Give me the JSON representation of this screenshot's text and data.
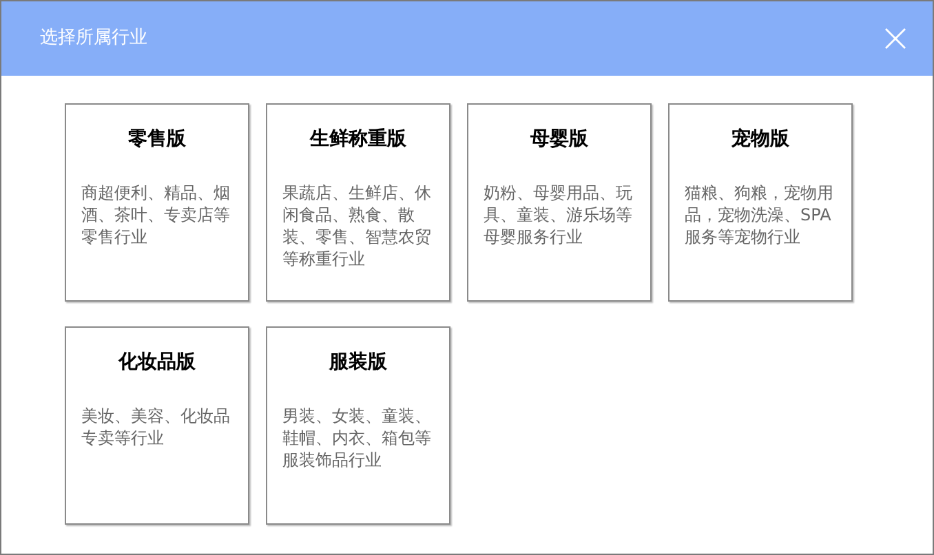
{
  "dialog": {
    "title": "选择所属行业"
  },
  "industries": [
    {
      "name": "零售版",
      "description": "商超便利、精品、烟酒、茶叶、专卖店等零售行业"
    },
    {
      "name": "生鲜称重版",
      "description": "果蔬店、生鲜店、休闲食品、熟食、散装、零售、智慧农贸等称重行业"
    },
    {
      "name": "母婴版",
      "description": "奶粉、母婴用品、玩具、童装、游乐场等母婴服务行业"
    },
    {
      "name": "宠物版",
      "description": "猫粮、狗粮，宠物用品，宠物洗澡、SPA服务等宠物行业"
    },
    {
      "name": "化妆品版",
      "description": "美妆、美容、化妆品专卖等行业"
    },
    {
      "name": "服装版",
      "description": "男装、女装、童装、鞋帽、内衣、箱包等服装饰品行业"
    }
  ]
}
